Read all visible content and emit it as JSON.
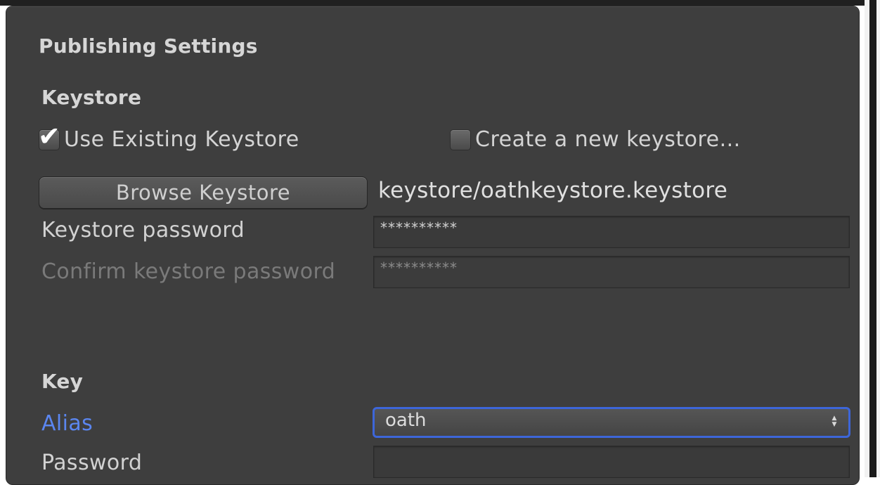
{
  "panel": {
    "title": "Publishing Settings"
  },
  "keystore": {
    "heading": "Keystore",
    "use_existing": {
      "label": "Use Existing Keystore",
      "checked": true
    },
    "create_new": {
      "label": "Create a new keystore...",
      "checked": false
    },
    "browse_button": "Browse Keystore",
    "path": "keystore/oathkeystore.keystore",
    "password_label": "Keystore password",
    "password_value": "**********",
    "confirm_label": "Confirm keystore password",
    "confirm_value": "**********"
  },
  "key": {
    "heading": "Key",
    "alias_label": "Alias",
    "alias_value": "oath",
    "password_label": "Password",
    "password_value": ""
  },
  "colors": {
    "panel_bg": "#3e3e3e",
    "accent": "#3d66d9",
    "alias_label": "#5b86f0"
  },
  "icons": {
    "checked": "checkmark-icon",
    "select_arrows": "up-down-arrows-icon"
  }
}
